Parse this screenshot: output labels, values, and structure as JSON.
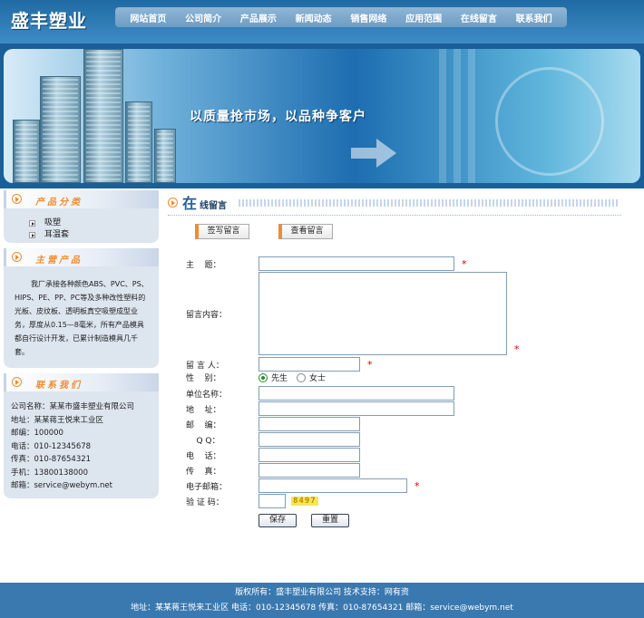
{
  "header": {
    "logo": "盛丰塑业",
    "nav": [
      "网站首页",
      "公司简介",
      "产品展示",
      "新闻动态",
      "销售网络",
      "应用范围",
      "在线留言",
      "联系我们"
    ]
  },
  "banner": {
    "slogan": "以质量抢市场，以品种争客户"
  },
  "sidebar": {
    "categories_title": "产品分类",
    "categories": [
      "吸塑",
      "耳温套"
    ],
    "products_title": "主营产品",
    "products_text": "我厂承接各种颜色ABS、PVC、PS、HIPS、PE、PP、PC等及多种改性塑料的光板、皮纹板、透明板真空吸塑成型业务，厚度从0.15—8毫米，所有产品模具都自行设计开发，已累计制造模具几千套。",
    "contact_title": "联系我们",
    "contact": [
      "公司名称：某某市盛丰塑业有限公司",
      "地址：某某蒋王悦来工业区",
      "邮编：100000",
      "电话：010-12345678",
      "传真：010-87654321",
      "手机：13800138000",
      "邮箱：service@webym.net"
    ]
  },
  "main": {
    "title_big": "在",
    "title_rest": "线留言",
    "tab_write": "签写留言",
    "tab_view": "查看留言",
    "form": {
      "subject": "主    题：",
      "content": "留言内容：",
      "author": "留 言 人：",
      "gender": "性    别：",
      "male": "先生",
      "female": "女士",
      "company": "单位名称：",
      "address": "地    址：",
      "zip": "邮    编：",
      "qq": "    Q Q：",
      "phone": "电    话：",
      "fax": "传    真：",
      "email": "电子邮箱：",
      "captcha": "验 证 码：",
      "captcha_code": "8497",
      "required_mark": "*",
      "save": "保存",
      "reset": "重置"
    }
  },
  "footer": {
    "line1": "版权所有：盛丰塑业有限公司    技术支持：网有资",
    "line2": "地址：某某蒋王悦来工业区 电话：010-12345678 传真：010-87654321 邮箱：service@webym.net"
  }
}
